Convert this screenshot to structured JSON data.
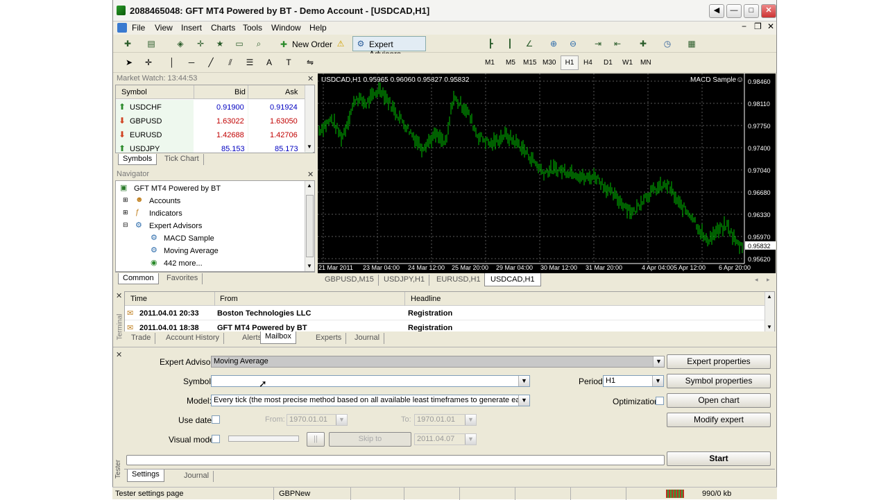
{
  "window": {
    "title": "2088465048: GFT MT4 Powered by BT - Demo Account - [USDCAD,H1]"
  },
  "menu": [
    "File",
    "View",
    "Insert",
    "Charts",
    "Tools",
    "Window",
    "Help"
  ],
  "toolbar": {
    "new_order": "New Order",
    "expert_advisors": "Expert Advisors",
    "timeframes": [
      "M1",
      "M5",
      "M15",
      "M30",
      "H1",
      "H4",
      "D1",
      "W1",
      "MN"
    ],
    "active_timeframe": "H1"
  },
  "market_watch": {
    "title": "Market Watch: 13:44:53",
    "columns": [
      "Symbol",
      "Bid",
      "Ask"
    ],
    "rows": [
      {
        "symbol": "USDCHF",
        "bid": "0.91900",
        "ask": "0.91924",
        "dir": "up"
      },
      {
        "symbol": "GBPUSD",
        "bid": "1.63022",
        "ask": "1.63050",
        "dir": "down"
      },
      {
        "symbol": "EURUSD",
        "bid": "1.42688",
        "ask": "1.42706",
        "dir": "down"
      },
      {
        "symbol": "USDJPY",
        "bid": "85.153",
        "ask": "85.173",
        "dir": "up"
      }
    ],
    "tabs": [
      "Symbols",
      "Tick Chart"
    ]
  },
  "navigator": {
    "title": "Navigator",
    "root": "GFT MT4 Powered by BT",
    "items": [
      "Accounts",
      "Indicators",
      "Expert Advisors"
    ],
    "experts": [
      "MACD Sample",
      "Moving Average",
      "442 more..."
    ],
    "tabs": [
      "Common",
      "Favorites"
    ]
  },
  "chart": {
    "header": "USDCAD,H1  0.95965 0.96060 0.95827 0.95832",
    "ea_label": "MACD Sample",
    "price_labels": [
      "0.98460",
      "0.98110",
      "0.97750",
      "0.97400",
      "0.97040",
      "0.96680",
      "0.96330",
      "0.95970",
      "0.95832",
      "0.95620"
    ],
    "date_labels": [
      "21 Mar 2011",
      "23 Mar 04:00",
      "24 Mar 12:00",
      "25 Mar 20:00",
      "29 Mar 04:00",
      "30 Mar 12:00",
      "31 Mar 20:00",
      "4 Apr 04:00",
      "5 Apr 12:00",
      "6 Apr 20:00"
    ],
    "tabs": [
      "GBPUSD,M15",
      "USDJPY,H1",
      "EURUSD,H1",
      "USDCAD,H1"
    ],
    "active_tab": "USDCAD,H1",
    "bar_color": "#00c000"
  },
  "terminal": {
    "side_label": "Terminal",
    "columns": [
      "Time",
      "From",
      "Headline"
    ],
    "rows": [
      {
        "time": "2011.04.01 20:33",
        "from": "Boston Technologies LLC",
        "headline": "Registration"
      },
      {
        "time": "2011.04.01 18:38",
        "from": "GFT MT4 Powered by BT",
        "headline": "Registration"
      }
    ],
    "tabs": [
      "Trade",
      "Account History",
      "Alerts",
      "Mailbox",
      "Experts",
      "Journal"
    ],
    "active_tab": "Mailbox"
  },
  "tester": {
    "side_label": "Tester",
    "expert_advisor_label": "Expert Advisor:",
    "expert_advisor_value": "Moving Average",
    "symbol_label": "Symbol:",
    "symbol_value": "",
    "model_label": "Model:",
    "model_value": "Every tick (the most precise method based on all available least timeframes to generate each",
    "period_label": "Period:",
    "period_value": "H1",
    "optimization_label": "Optimization",
    "use_date_label": "Use date",
    "from_label": "From:",
    "from_value": "1970.01.01",
    "to_label": "To:",
    "to_value": "1970.01.01",
    "visual_mode_label": "Visual mode",
    "pause_label": "||",
    "skip_to_label": "Skip to",
    "skip_to_value": "2011.04.07",
    "buttons": {
      "expert_properties": "Expert properties",
      "symbol_properties": "Symbol properties",
      "open_chart": "Open chart",
      "modify_expert": "Modify expert",
      "start": "Start"
    },
    "tabs": [
      "Settings",
      "Journal"
    ],
    "active_tab": "Settings"
  },
  "status": {
    "text": "Tester settings page",
    "profile": "GBPNew",
    "traffic": "990/0 kb"
  }
}
